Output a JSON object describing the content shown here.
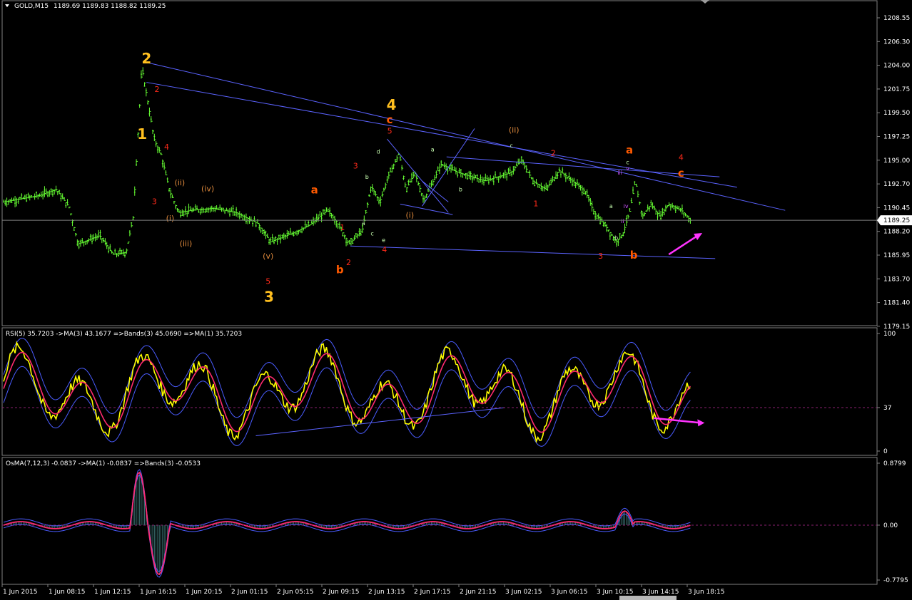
{
  "colors": {
    "background": "#000000",
    "grid": "#808080",
    "bull_candle": "#66ff33",
    "text": "#ffffff",
    "trendline": "#5b63ff",
    "wave_major": "#ffbf1f",
    "wave_red": "#ff2a1a",
    "wave_orange": "#ff5a00",
    "wave_minor": "#ffcc66",
    "wave_subminor": "#e08a3c",
    "wave_green": "#c8ffb0",
    "wave_magenta": "#cc55ff",
    "rsi_line": "#ffff00",
    "rsi_ma": "#ff2a6e",
    "bands": "#4a5cff",
    "arrow": "#ff33ff",
    "osma_hist": "#3a7070",
    "osma_ma": "#ff2a6e"
  },
  "header": {
    "symbol_label": "GOLD,M15",
    "ohlc_label": "1189.69 1189.83 1188.82 1189.25"
  },
  "chart_data": [
    {
      "type": "candlestick",
      "title": "GOLD,M15",
      "ohlc": {
        "open": 1189.69,
        "high": 1189.83,
        "low": 1188.82,
        "close": 1189.25
      },
      "current_price": "1189.25",
      "y_ticks": [
        "1208.55",
        "1206.30",
        "1204.00",
        "1201.75",
        "1199.50",
        "1197.25",
        "1195.00",
        "1192.70",
        "1190.45",
        "1188.20",
        "1185.95",
        "1183.70",
        "1181.40",
        "1179.15"
      ],
      "ylim": [
        1179.15,
        1208.55
      ],
      "x_ticks": [
        "1 Jun 2015",
        "1 Jun 08:15",
        "1 Jun 12:15",
        "1 Jun 16:15",
        "1 Jun 20:15",
        "2 Jun 01:15",
        "2 Jun 05:15",
        "2 Jun 09:15",
        "2 Jun 13:15",
        "2 Jun 17:15",
        "2 Jun 21:15",
        "3 Jun 02:15",
        "3 Jun 06:15",
        "3 Jun 10:15",
        "3 Jun 14:15",
        "3 Jun 18:15"
      ],
      "wave_labels": [
        {
          "text": "2",
          "style": "major",
          "price": 1204.2,
          "pos": 0.165
        },
        {
          "text": "1",
          "style": "major",
          "price": 1197.0,
          "pos": 0.16
        },
        {
          "text": "3",
          "style": "major",
          "price": 1181.5,
          "pos": 0.305
        },
        {
          "text": "4",
          "style": "major",
          "price": 1199.8,
          "pos": 0.445
        },
        {
          "text": "2",
          "style": "red",
          "price": 1201.5,
          "pos": 0.177
        },
        {
          "text": "4",
          "style": "red",
          "price": 1196.0,
          "pos": 0.188
        },
        {
          "text": "3",
          "style": "red",
          "price": 1190.8,
          "pos": 0.174
        },
        {
          "text": "5",
          "style": "red",
          "price": 1183.2,
          "pos": 0.304
        },
        {
          "text": "1",
          "style": "red",
          "price": 1188.3,
          "pos": 0.389
        },
        {
          "text": "2",
          "style": "red",
          "price": 1185.0,
          "pos": 0.396
        },
        {
          "text": "3",
          "style": "red",
          "price": 1194.2,
          "pos": 0.404
        },
        {
          "text": "5",
          "style": "red",
          "price": 1197.5,
          "pos": 0.443
        },
        {
          "text": "4",
          "style": "red",
          "price": 1186.2,
          "pos": 0.437
        },
        {
          "text": "1",
          "style": "red",
          "price": 1190.6,
          "pos": 0.61
        },
        {
          "text": "2",
          "style": "red",
          "price": 1195.4,
          "pos": 0.63
        },
        {
          "text": "3",
          "style": "red",
          "price": 1185.6,
          "pos": 0.684
        },
        {
          "text": "4",
          "style": "red",
          "price": 1195.0,
          "pos": 0.776
        },
        {
          "text": "a",
          "style": "orange",
          "price": 1191.8,
          "pos": 0.357
        },
        {
          "text": "b",
          "style": "orange",
          "price": 1184.2,
          "pos": 0.386
        },
        {
          "text": "c",
          "style": "orange",
          "price": 1198.5,
          "pos": 0.443
        },
        {
          "text": "a",
          "style": "orange",
          "price": 1195.6,
          "pos": 0.717
        },
        {
          "text": "b",
          "style": "orange",
          "price": 1185.6,
          "pos": 0.722
        },
        {
          "text": "c",
          "style": "orange",
          "price": 1193.4,
          "pos": 0.776
        },
        {
          "text": "(ii)",
          "style": "minor",
          "price": 1192.6,
          "pos": 0.203
        },
        {
          "text": "(iv)",
          "style": "minor",
          "price": 1192.0,
          "pos": 0.235
        },
        {
          "text": "(i)",
          "style": "minor",
          "price": 1189.2,
          "pos": 0.192
        },
        {
          "text": "(iii)",
          "style": "minor",
          "price": 1186.8,
          "pos": 0.21
        },
        {
          "text": "(v)",
          "style": "minor",
          "price": 1185.6,
          "pos": 0.304
        },
        {
          "text": "(i)",
          "style": "minor",
          "price": 1189.5,
          "pos": 0.466
        },
        {
          "text": "(ii)",
          "style": "minor",
          "price": 1197.6,
          "pos": 0.585
        },
        {
          "text": "a",
          "style": "green",
          "price": 1188.8,
          "pos": 0.413
        },
        {
          "text": "c",
          "style": "green",
          "price": 1187.8,
          "pos": 0.423
        },
        {
          "text": "b",
          "style": "green",
          "price": 1193.2,
          "pos": 0.417
        },
        {
          "text": "d",
          "style": "green",
          "price": 1195.6,
          "pos": 0.43
        },
        {
          "text": "e",
          "style": "green",
          "price": 1187.2,
          "pos": 0.436
        },
        {
          "text": "a",
          "style": "green",
          "price": 1195.8,
          "pos": 0.492
        },
        {
          "text": "b",
          "style": "green",
          "price": 1192.0,
          "pos": 0.524
        },
        {
          "text": "c",
          "style": "green",
          "price": 1196.2,
          "pos": 0.582
        },
        {
          "text": "a",
          "style": "green",
          "price": 1190.4,
          "pos": 0.696
        },
        {
          "text": "b",
          "style": "green",
          "price": 1187.4,
          "pos": 0.702
        },
        {
          "text": "c",
          "style": "green",
          "price": 1194.6,
          "pos": 0.715
        },
        {
          "text": "iii",
          "style": "magenta",
          "price": 1193.6,
          "pos": 0.706
        },
        {
          "text": "v",
          "style": "magenta",
          "price": 1194.0,
          "pos": 0.715
        },
        {
          "text": "iv",
          "style": "magenta",
          "price": 1190.4,
          "pos": 0.713
        },
        {
          "text": "ii",
          "style": "magenta",
          "price": 1189.0,
          "pos": 0.709
        }
      ]
    },
    {
      "type": "line",
      "title": "RSI(5)",
      "legend_label": "RSI(5) 35.7203  ->MA(3) 43.1677  =>Bands(3) 45.0690  =>MA(1) 35.7203",
      "series": [
        {
          "name": "RSI(5)",
          "last": 35.7203
        },
        {
          "name": "MA(3)",
          "last": 43.1677
        },
        {
          "name": "Bands(3)",
          "last": 45.069
        },
        {
          "name": "MA(1)",
          "last": 35.7203
        }
      ],
      "ylim": [
        0,
        100
      ],
      "y_ticks": [
        "100",
        "37",
        "0"
      ],
      "level": 37
    },
    {
      "type": "bar",
      "title": "OsMA(7,12,3)",
      "legend_label": "OsMA(7,12,3) -0.0837  ->MA(1) -0.0837  =>Bands(3) -0.0533",
      "series": [
        {
          "name": "OsMA(7,12,3)",
          "last": -0.0837
        },
        {
          "name": "MA(1)",
          "last": -0.0837
        },
        {
          "name": "Bands(3)",
          "last": -0.0533
        }
      ],
      "ylim": [
        -0.7795,
        0.8799
      ],
      "y_ticks": [
        "0.8799",
        "0.00",
        "-0.7795"
      ]
    }
  ]
}
